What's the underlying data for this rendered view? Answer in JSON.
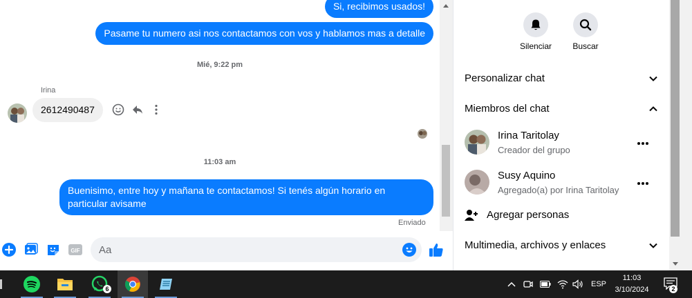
{
  "chat": {
    "messages_out_top": [
      "Si, recibimos usados!",
      "Pasame tu numero asi nos contactamos con vos y hablamos mas a detalle"
    ],
    "timestamp_1": "Mié, 9:22 pm",
    "incoming_sender": "Irina",
    "incoming_message": "2612490487",
    "timestamp_2": "11:03 am",
    "last_message": "Buenisimo, entre hoy y mañana te contactamos! Si tenés algún horario en particular avisame",
    "delivery_status": "Enviado",
    "input_placeholder": "Aa",
    "accent_color": "#0a7cff"
  },
  "panel": {
    "mute_label": "Silenciar",
    "search_label": "Buscar",
    "customize_label": "Personalizar chat",
    "members_label": "Miembros del chat",
    "members": [
      {
        "name": "Irina Taritolay",
        "role": "Creador del grupo"
      },
      {
        "name": "Susy Aquino",
        "role": "Agregado(a) por Irina Taritolay"
      }
    ],
    "add_people_label": "Agregar personas",
    "media_label": "Multimedia, archivos y enlaces"
  },
  "taskbar": {
    "apps": [
      "spotify-icon",
      "file-explorer-icon",
      "whatsapp-icon",
      "chrome-icon",
      "notepad-icon"
    ],
    "whatsapp_badge": "6",
    "language": "ESP",
    "time": "11:03",
    "date": "3/10/2024",
    "notifications_count": "2"
  }
}
